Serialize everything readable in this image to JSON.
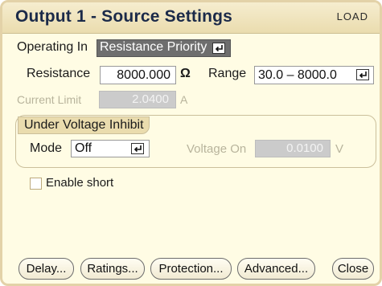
{
  "window": {
    "title": "Output 1 - Source Settings",
    "tag": "LOAD"
  },
  "operating": {
    "label": "Operating In",
    "value": "Resistance Priority"
  },
  "resistance": {
    "label": "Resistance",
    "value": "8000.000",
    "unit": "Ω"
  },
  "range": {
    "label": "Range",
    "value": "30.0 – 8000.0"
  },
  "current_limit": {
    "label": "Current Limit",
    "value": "2.0400",
    "unit": "A"
  },
  "uvi": {
    "title": "Under Voltage Inhibit",
    "mode_label": "Mode",
    "mode_value": "Off",
    "voltage_label": "Voltage On",
    "voltage_value": "0.0100",
    "voltage_unit": "V"
  },
  "enable_short": {
    "label": "Enable short",
    "checked": false
  },
  "buttons": {
    "delay": "Delay...",
    "ratings": "Ratings...",
    "protection": "Protection...",
    "advanced": "Advanced...",
    "close": "Close"
  }
}
